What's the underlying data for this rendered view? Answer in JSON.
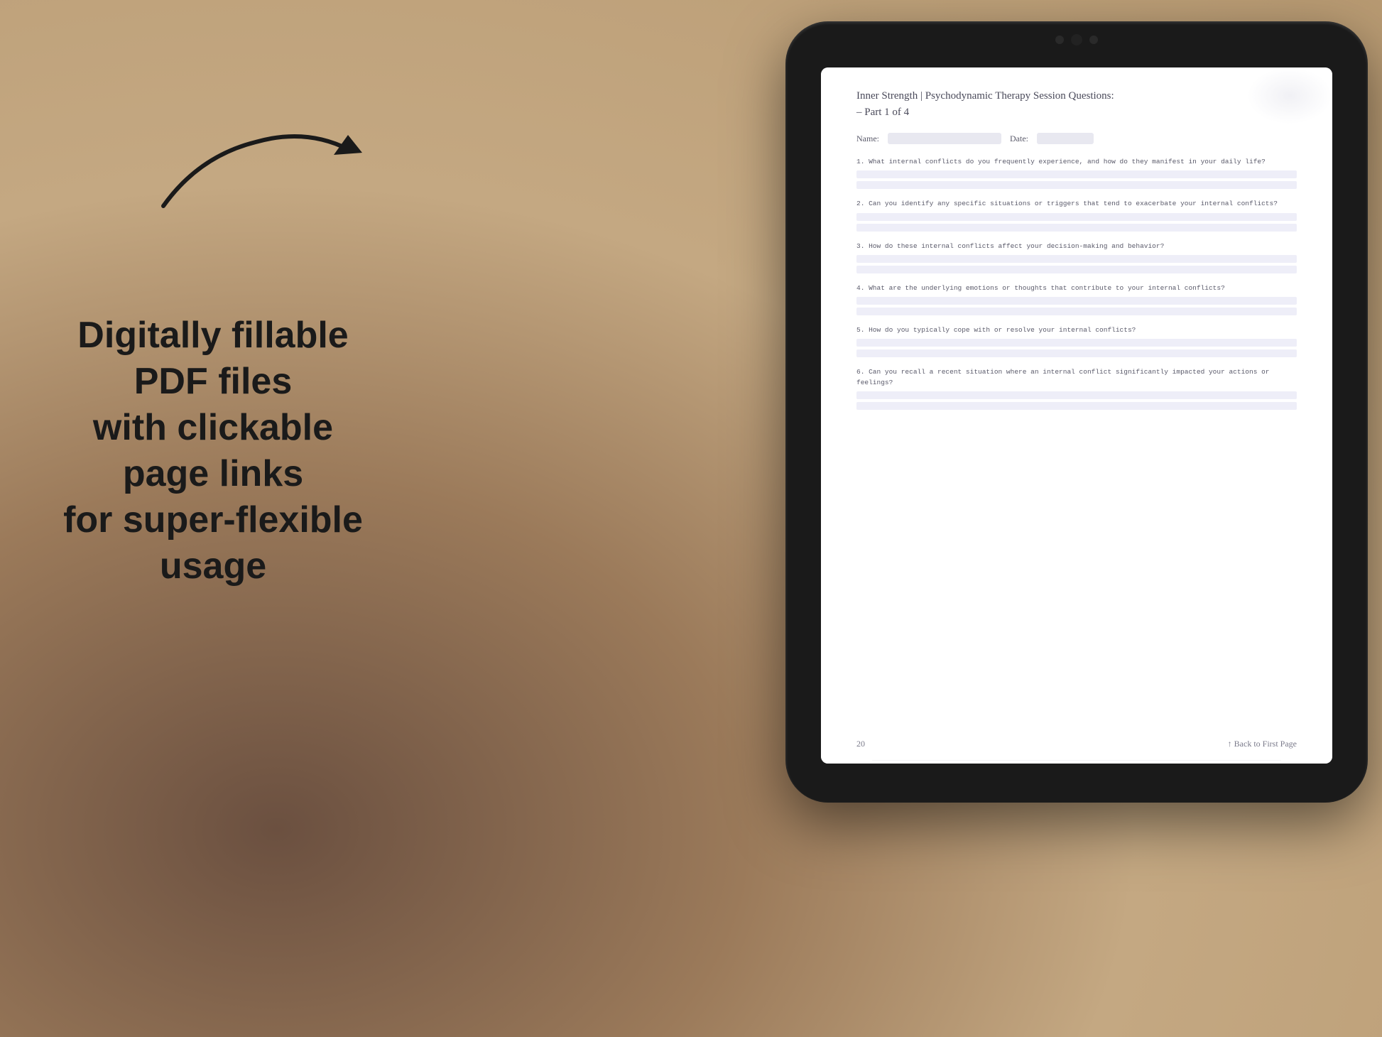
{
  "background": {
    "color": "#c4a882"
  },
  "left_panel": {
    "arrow_label": "arrow pointing right",
    "main_text_line1": "Digitally fillable PDF files",
    "main_text_line2": "with clickable page links",
    "main_text_line3": "for super-flexible usage"
  },
  "tablet": {
    "camera_dots": 3,
    "screen": {
      "pdf_page": {
        "title_line1": "Inner Strength | Psychodynamic Therapy Session Questions:",
        "title_line2": "– Part 1 of 4",
        "name_label": "Name:",
        "date_label": "Date:",
        "questions": [
          {
            "number": "1.",
            "text": "What internal conflicts do you frequently experience, and how do they manifest in your\ndaily life?",
            "answer_lines": 2
          },
          {
            "number": "2.",
            "text": "Can you identify any specific situations or triggers that tend to exacerbate your internal\nconflicts?",
            "answer_lines": 2
          },
          {
            "number": "3.",
            "text": "How do these internal conflicts affect your decision-making and behavior?",
            "answer_lines": 2
          },
          {
            "number": "4.",
            "text": "What are the underlying emotions or thoughts that contribute to your internal conflicts?",
            "answer_lines": 2
          },
          {
            "number": "5.",
            "text": "How do you typically cope with or resolve your internal conflicts?",
            "answer_lines": 2
          },
          {
            "number": "6.",
            "text": "Can you recall a recent situation where an internal conflict significantly impacted your\nactions or feelings?",
            "answer_lines": 2
          }
        ],
        "footer": {
          "page_number": "20",
          "back_link": "↑ Back to First Page"
        }
      }
    }
  }
}
